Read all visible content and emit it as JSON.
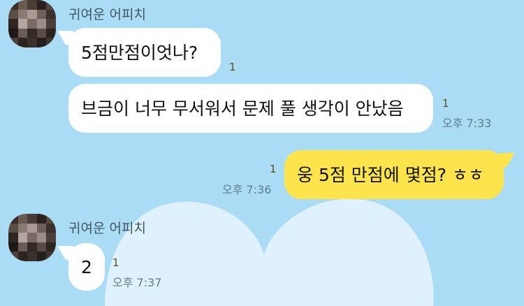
{
  "colors": {
    "background": "#abdcf6",
    "my_bubble": "#fde44c",
    "their_bubble": "#ffffff",
    "heart": "#dff1fd"
  },
  "messages": [
    {
      "sender": "귀여운 어피치",
      "text": "5점만점이엇나?",
      "unread": "1",
      "time": ""
    },
    {
      "text": "브금이 너무 무서워서 문제 풀 생각이 안났음",
      "unread": "1",
      "time": "오후 7:33"
    },
    {
      "text": "웅 5점 만점에 몇점? ㅎㅎ",
      "unread": "1",
      "time": "오후 7:36"
    },
    {
      "sender": "귀여운 어피치",
      "text": "2",
      "unread": "1",
      "time": "오후 7:37"
    }
  ]
}
